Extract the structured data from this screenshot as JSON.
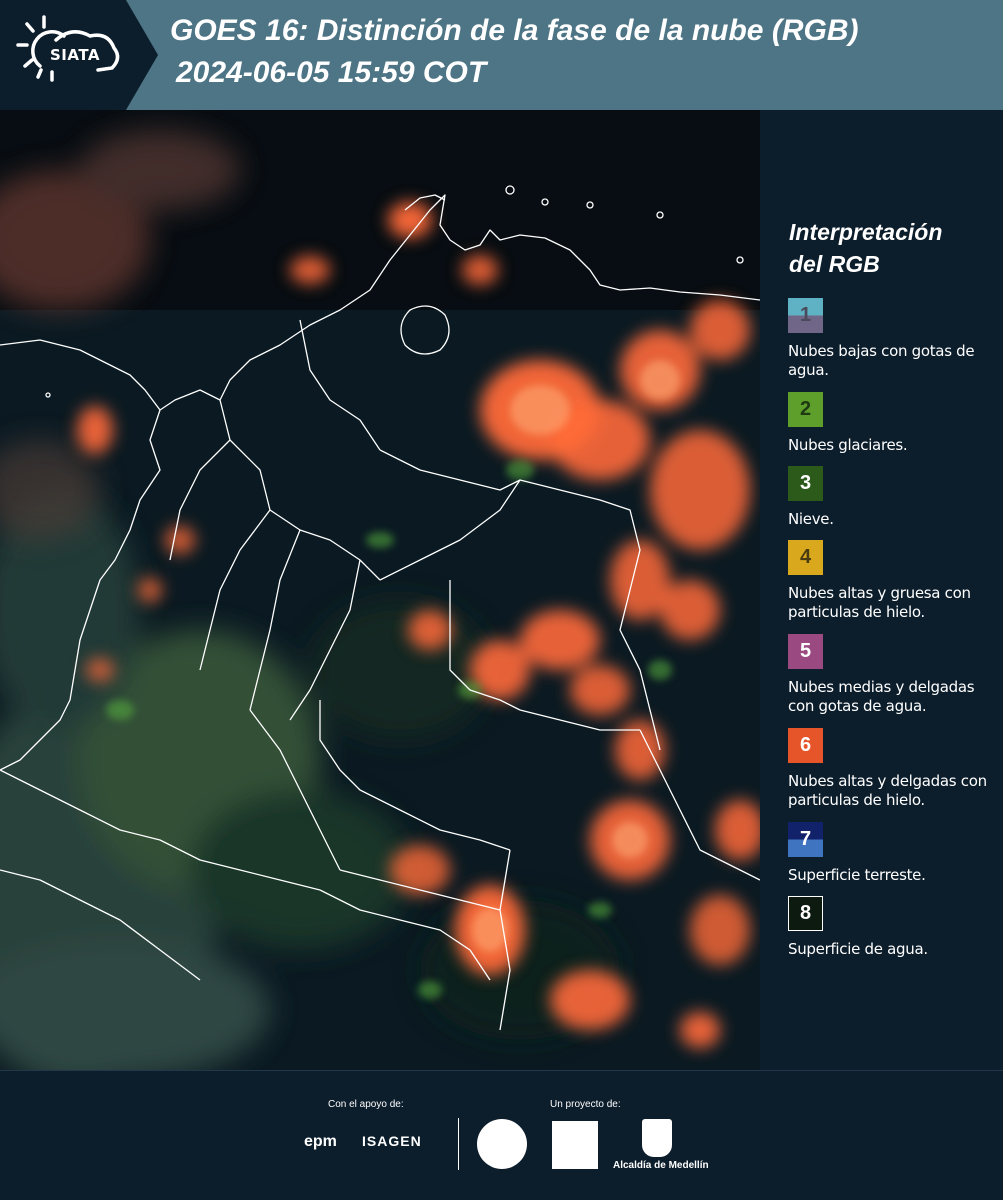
{
  "header": {
    "logo_text": "SIATA",
    "title": "GOES 16: Distinción de la fase de la nube (RGB)",
    "datetime": "2024-06-05 15:59 COT"
  },
  "legend": {
    "title_line1": "Interpretación",
    "title_line2": "del RGB",
    "items": [
      {
        "number": "1",
        "label": "Nubes bajas con gotas de agua.",
        "color_top": "#5fb2c4",
        "color_bottom": "#6f6688",
        "number_color": "#4a4a5a"
      },
      {
        "number": "2",
        "label": "Nubes glaciares.",
        "color_top": "#5e9f2c",
        "color_bottom": "#5e9f2c",
        "number_color": "#1e3a12"
      },
      {
        "number": "3",
        "label": "Nieve.",
        "color_top": "#2c5a1b",
        "color_bottom": "#2c5a1b",
        "number_color": "#ffffff"
      },
      {
        "number": "4",
        "label": "Nubes altas y gruesa con particulas de hielo.",
        "color_top": "#d9a81d",
        "color_bottom": "#d9a81d",
        "number_color": "#4a3a10"
      },
      {
        "number": "5",
        "label": "Nubes medias y delgadas con gotas de agua.",
        "color_top": "#9a4a80",
        "color_bottom": "#9a4a80",
        "number_color": "#ffffff"
      },
      {
        "number": "6",
        "label": "Nubes altas y delgadas con particulas de hielo.",
        "color_top": "#e65429",
        "color_bottom": "#e65429",
        "number_color": "#ffffff"
      },
      {
        "number": "7",
        "label": "Superficie terreste.",
        "color_top": "#12226a",
        "color_bottom": "#3f74c0",
        "number_color": "#ffffff"
      },
      {
        "number": "8",
        "label": "Superficie de agua.",
        "color_top": "#0d1a10",
        "color_bottom": "#0d1a10",
        "number_color": "#ffffff"
      }
    ]
  },
  "footer": {
    "support_label": "Con el apoyo de:",
    "project_label": "Un proyecto de:",
    "sponsor_epm": "epm",
    "sponsor_isagen": "ISAGEN",
    "partner_medellin": "Alcaldía de Medellín"
  },
  "colors": {
    "header_bg": "#4d7585",
    "logo_bg": "#0c1d2b",
    "page_bg": "#0c1d2b",
    "cloud_orange": "#ff6a3a",
    "border_white": "#ffffff"
  }
}
